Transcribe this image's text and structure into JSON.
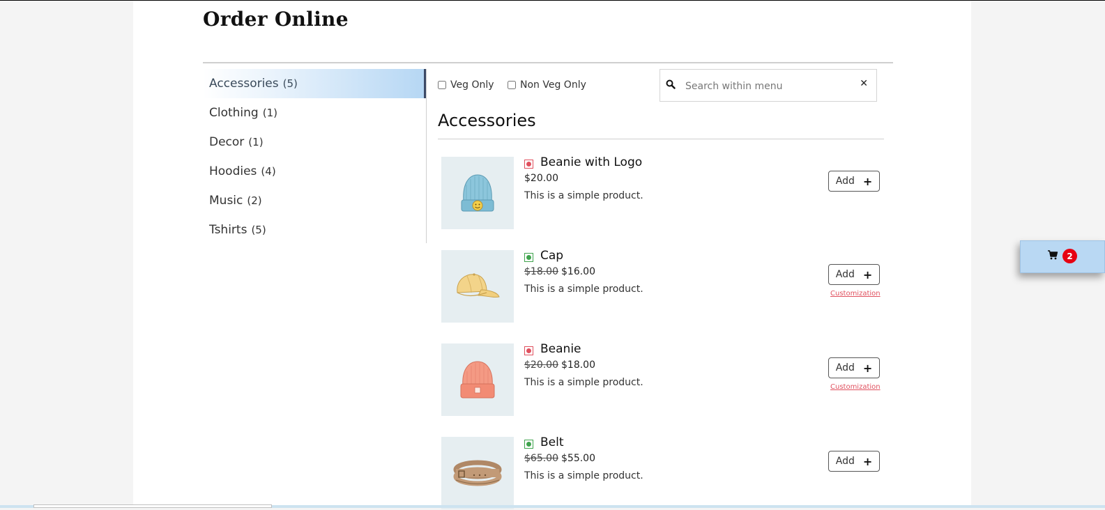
{
  "header": {
    "title": "Order Online"
  },
  "sidebar": {
    "categories": [
      {
        "label": "Accessories",
        "count": "(5)",
        "active": true
      },
      {
        "label": "Clothing",
        "count": "(1)"
      },
      {
        "label": "Decor",
        "count": "(1)"
      },
      {
        "label": "Hoodies",
        "count": "(4)"
      },
      {
        "label": "Music",
        "count": "(2)"
      },
      {
        "label": "Tshirts",
        "count": "(5)"
      }
    ]
  },
  "filters": {
    "veg_label": "Veg Only",
    "nonveg_label": "Non Veg Only",
    "veg_checked": false,
    "nonveg_checked": false
  },
  "search": {
    "placeholder": "Search within menu",
    "value": "",
    "clear_icon": "close-icon"
  },
  "section": {
    "title": "Accessories"
  },
  "products": [
    {
      "name": "Beanie with Logo",
      "diet": "non-veg",
      "old_price": "",
      "price": "$20.00",
      "description": "This is a simple product.",
      "add_label": "Add",
      "customization": "",
      "image": "blue-beanie-with-logo"
    },
    {
      "name": "Cap",
      "diet": "veg",
      "old_price": "$18.00",
      "price": "$16.00",
      "description": "This is a simple product.",
      "add_label": "Add",
      "customization": "Customization",
      "image": "yellow-cap"
    },
    {
      "name": "Beanie",
      "diet": "non-veg",
      "old_price": "$20.00",
      "price": "$18.00",
      "description": "This is a simple product.",
      "add_label": "Add",
      "customization": "Customization",
      "image": "orange-beanie"
    },
    {
      "name": "Belt",
      "diet": "veg",
      "old_price": "$65.00",
      "price": "$55.00",
      "description": "This is a simple product.",
      "add_label": "Add",
      "customization": "",
      "image": "brown-belt"
    }
  ],
  "cart": {
    "count": "2",
    "icon": "cart-icon",
    "color": "#b9d8f3",
    "badge_color": "#e60012"
  },
  "colors": {
    "non_veg": "#e0505e",
    "veg": "#3fa34d",
    "active_category_accent": "#3c4a66"
  }
}
